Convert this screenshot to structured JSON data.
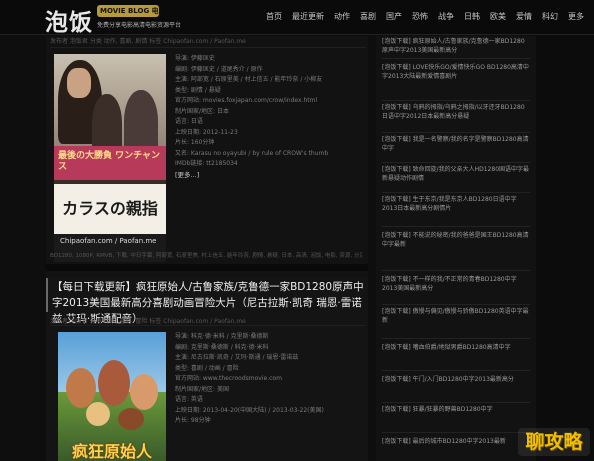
{
  "site": {
    "logo": "泡饭",
    "logo_badge": "MOVIE BLOG 电影资讯",
    "logo_sub": "免费分享电影高清电影资源平台"
  },
  "nav": [
    "首页",
    "最近更新",
    "动作",
    "喜剧",
    "国产",
    "恐怖",
    "战争",
    "日韩",
    "欧美",
    "爱情",
    "科幻",
    "更多"
  ],
  "post1": {
    "meta": "发布者 泡饭君 分类 动作, 喜剧, 剧情 标签 Chipaofan.com / Paofan.me",
    "poster": {
      "tagline": "最後の大勝負 ワンチャンス",
      "title": "カラスの親指",
      "credit": "Chipaofan.com / Paofan.me"
    },
    "info": [
      "导演: 伊藤匡史",
      "编剧: 伊藤匡史 / 道尾秀介 / 原作",
      "主演: 阿部宽 / 石原里美 / 村上信五 / 能年玲奈 / 小柳友",
      "类型: 剧情 / 悬疑",
      "官方网站: movies.foxjapan.com/crow/index.html",
      "制片国家/地区: 日本",
      "语言: 日语",
      "上映日期: 2012-11-23",
      "片长: 160分钟",
      "又名: Karasu no oyayubi / by rule of CROW's thumb",
      "IMDb链接: tt2185034"
    ],
    "more": "[更多...]",
    "tags": "BD1280, 1080P, RMVB, 下载, 中日字幕, 阿部宽, 石原里美, 村上信五, 能年玲奈, 剧情, 悬疑, 日本, 高清, 泡饭, 电影, 资源, 分享"
  },
  "post2": {
    "title": "【每日下载更新】疯狂原始人/古鲁家族/克鲁德一家BD1280原声中字2013美国最新高分喜剧动画冒险大片（尼古拉斯·凯奇 瑞恩·雷诺兹 艾玛·斯通配音）",
    "meta": "发布者 泡饭君 分类 动画, 喜剧, 冒险 标签 Chipaofan.com / Paofan.me",
    "poster_title": "疯狂原始人",
    "info": [
      "导演: 科克·德·米科 / 克里斯·桑德斯",
      "编剧: 克里斯·桑德斯 / 科克·德·米科",
      "主演: 尼古拉斯·凯奇 / 艾玛·斯通 / 瑞恩·雷诺兹",
      "类型: 喜剧 / 动画 / 冒险",
      "官方网站: www.thecroodsmovie.com",
      "制片国家/地区: 美国",
      "语言: 英语",
      "上映日期: 2013-04-20(中国大陆) / 2013-03-22(美国)",
      "片长: 98分钟"
    ]
  },
  "sidebar": [
    "[泡饭下载] 疯狂原始人/古鲁家族/克鲁德一家BD1280原声中字2013美国最新高分",
    "[泡饭下载] LOVE快乐GO/爱情快乐GO BD1280高清中字2013大陆最新爱情喜剧片",
    "[泡饭下载] 乌鸦的拇指/乌鸦之拇指/以牙还牙BD1280日语中字2012日本最新高分悬疑",
    "[泡饭下载] 我是一名警察/我的名字是警察BD1280高清中字",
    "[泡饭下载] 致命回旋/我的父亲大人HD1280国语中字最新悬疑动作剧情",
    "[泡饭下载] 生于东京/我是东京人BD1280日语中字2013日本最新高分剧情片",
    "[泡饭下载] 不能说的秘密/我的爸爸是国王BD1280高清中字最新",
    "[泡饭下载] 不一样的我/不正常的青春BD1280中字2013美国最新高分",
    "[泡饭下载] 傲慢与偏见/傲慢与骄傲BD1280英语中字最新",
    "[泡饭下载] 嗜血伯爵/地狱男爵BD1280高清中字",
    "[泡饭下载] 午门/入门BD1280中字2013最新高分",
    "[泡饭下载] 狂暴/狂暴的野兽BD1280中字",
    "[泡饭下载] 最后的城市BD1280中字2013最新"
  ],
  "watermark": "聊攻略"
}
